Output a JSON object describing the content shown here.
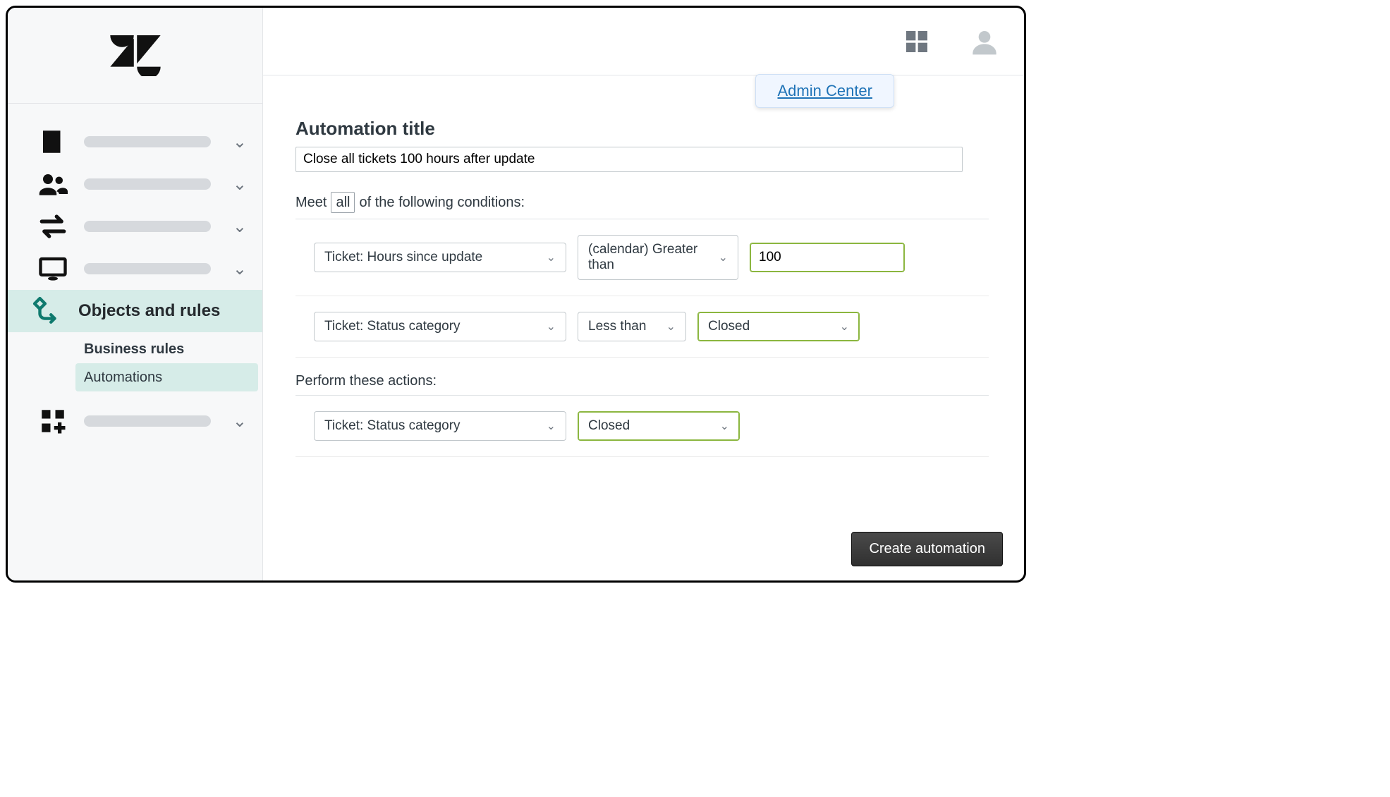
{
  "tooltip": {
    "label": "Admin Center"
  },
  "sidebar": {
    "active_label": "Objects and rules",
    "sub_items": [
      {
        "label": "Business rules",
        "selected": false
      },
      {
        "label": "Automations",
        "selected": true
      }
    ]
  },
  "form": {
    "title_label": "Automation title",
    "title_value": "Close all tickets 100 hours after update",
    "conditions_prefix": "Meet",
    "conditions_mode": "all",
    "conditions_suffix": "of the following conditions:",
    "conditions": [
      {
        "field": "Ticket: Hours since update",
        "operator": "(calendar) Greater than",
        "value": "100",
        "value_type": "input"
      },
      {
        "field": "Ticket: Status category",
        "operator": "Less than",
        "value": "Closed",
        "value_type": "select"
      }
    ],
    "actions_label": "Perform these actions:",
    "actions": [
      {
        "field": "Ticket: Status category",
        "value": "Closed"
      }
    ],
    "create_button": "Create automation"
  }
}
